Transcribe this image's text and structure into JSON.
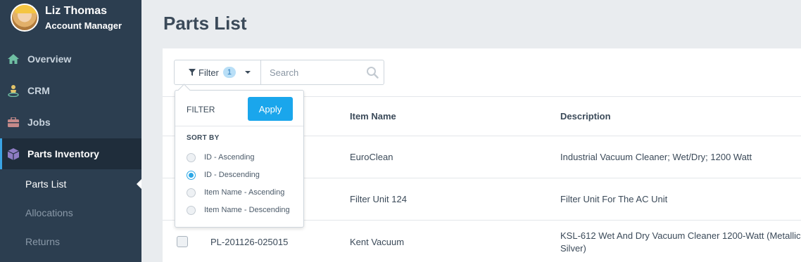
{
  "user": {
    "name": "Liz Thomas",
    "role": "Account Manager"
  },
  "nav": {
    "overview": "Overview",
    "crm": "CRM",
    "jobs": "Jobs",
    "parts_inventory": "Parts Inventory",
    "sub": {
      "parts_list": "Parts List",
      "allocations": "Allocations",
      "returns": "Returns"
    }
  },
  "page": {
    "title": "Parts List"
  },
  "toolbar": {
    "filter_label": "Filter",
    "filter_count": "1",
    "search_placeholder": "Search"
  },
  "filter_menu": {
    "heading": "FILTER",
    "apply_label": "Apply",
    "sort_by_label": "SORT BY",
    "options": [
      "ID - Ascending",
      "ID - Descending",
      "Item Name - Ascending",
      "Item Name - Descending"
    ],
    "selected": "ID - Descending"
  },
  "table": {
    "columns": {
      "item_name": "Item Name",
      "description": "Description"
    },
    "rows": [
      {
        "id": "",
        "item_name": "EuroClean",
        "description": "Industrial Vacuum Cleaner; Wet/Dry; 1200 Watt"
      },
      {
        "id": "",
        "item_name": "Filter Unit 124",
        "description": "Filter Unit For The AC Unit"
      },
      {
        "id": "PL-201126-025015",
        "item_name": "Kent Vacuum",
        "description_line1": "KSL-612 Wet And Dry Vacuum Cleaner 1200-Watt (Metallic",
        "description_line2": "Silver)"
      }
    ]
  },
  "colors": {
    "sidebar": "#2c3e50",
    "accent": "#1aa6ec"
  }
}
